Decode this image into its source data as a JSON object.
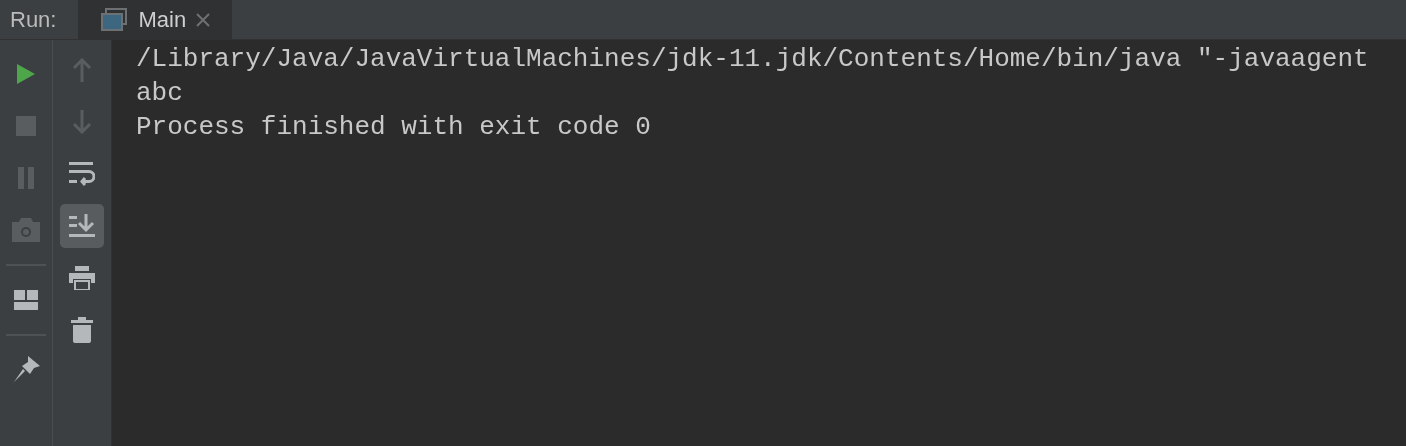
{
  "header": {
    "label": "Run:",
    "tabs": [
      {
        "label": "Main",
        "selected": true,
        "closable": true
      }
    ]
  },
  "left_toolbar": [
    {
      "kind": "play",
      "disabled": false
    },
    {
      "kind": "stop",
      "disabled": true
    },
    {
      "kind": "pause",
      "disabled": true
    },
    {
      "kind": "camera",
      "disabled": true
    },
    {
      "kind": "separator"
    },
    {
      "kind": "layout",
      "disabled": false
    },
    {
      "kind": "separator"
    },
    {
      "kind": "pin",
      "disabled": false
    }
  ],
  "right_toolbar": [
    {
      "kind": "up",
      "disabled": true,
      "selected": false
    },
    {
      "kind": "down",
      "disabled": true,
      "selected": false
    },
    {
      "kind": "wrap",
      "disabled": false,
      "selected": false
    },
    {
      "kind": "scroll-end",
      "disabled": false,
      "selected": true
    },
    {
      "kind": "print",
      "disabled": false,
      "selected": false
    },
    {
      "kind": "trash",
      "disabled": false,
      "selected": false
    }
  ],
  "console": {
    "lines": [
      "/Library/Java/JavaVirtualMachines/jdk-11.jdk/Contents/Home/bin/java \"-javaagent",
      "abc",
      "Process finished with exit code 0"
    ]
  }
}
